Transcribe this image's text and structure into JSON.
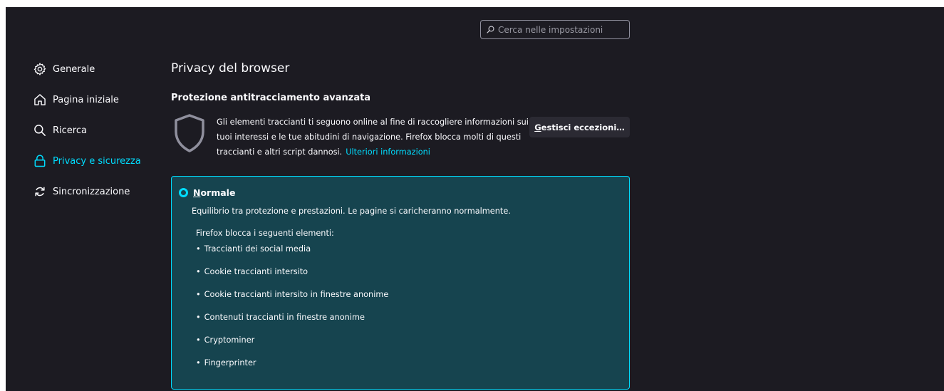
{
  "search": {
    "placeholder": "Cerca nelle impostazioni"
  },
  "sidebar": {
    "items": [
      {
        "label": "Generale",
        "icon": "gear-icon"
      },
      {
        "label": "Pagina iniziale",
        "icon": "home-icon"
      },
      {
        "label": "Ricerca",
        "icon": "search-icon"
      },
      {
        "label": "Privacy e sicurezza",
        "icon": "lock-icon",
        "selected": true
      },
      {
        "label": "Sincronizzazione",
        "icon": "sync-icon"
      }
    ]
  },
  "main": {
    "title": "Privacy del browser",
    "section_heading": "Protezione antitracciamento avanzata",
    "description": "Gli elementi traccianti ti seguono online al fine di raccogliere informazioni sui tuoi interessi e le tue abitudini di navigazione. Firefox blocca molti di questi traccianti e altri script dannosi.",
    "learn_more": "Ulteriori informazioni",
    "manage_button": {
      "access_key": "G",
      "rest": "estisci eccezioni…"
    }
  },
  "protection": {
    "option": {
      "access_key": "N",
      "rest": "ormale",
      "selected": true
    },
    "option_description": "Equilibrio tra protezione e prestazioni. Le pagine si caricheranno normalmente.",
    "blocks_title": "Firefox blocca i seguenti elementi:",
    "bullet": "•",
    "items": [
      "Traccianti dei social media",
      "Cookie traccianti intersito",
      "Cookie traccianti intersito in finestre anonime",
      "Contenuti traccianti in finestre anonime",
      "Cryptominer",
      "Fingerprinter"
    ]
  },
  "colors": {
    "background": "#1c1b22",
    "text": "#fbfbfe",
    "accent": "#00ddff",
    "selected_box_bg": "#16444f",
    "button_bg": "#2b2a33"
  }
}
